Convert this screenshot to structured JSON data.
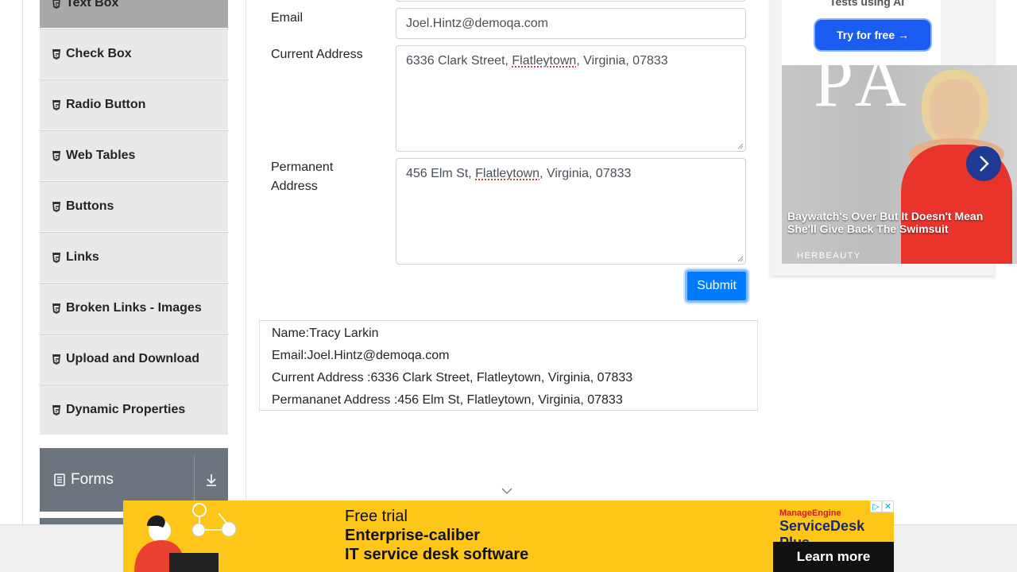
{
  "sidebar": {
    "items": [
      {
        "label": "Text Box",
        "active": true
      },
      {
        "label": "Check Box"
      },
      {
        "label": "Radio Button"
      },
      {
        "label": "Web Tables"
      },
      {
        "label": "Buttons"
      },
      {
        "label": "Links"
      },
      {
        "label": "Broken Links - Images"
      },
      {
        "label": "Upload and Download"
      },
      {
        "label": "Dynamic Properties"
      }
    ],
    "group_label": "Forms"
  },
  "form": {
    "email_label": "Email",
    "email_value": "Joel.Hintz@demoqa.com",
    "current_address_label": "Current Address",
    "current_address_parts": [
      "6336 Clark Street, ",
      "Flatleytown",
      ", Virginia, 07833"
    ],
    "permanent_address_label_1": "Permanent",
    "permanent_address_label_2": "Address",
    "permanent_address_parts": [
      "456 Elm St, ",
      "Flatleytown",
      ", Virginia, 07833"
    ],
    "submit_label": "Submit"
  },
  "output": {
    "name": "Name:Tracy Larkin",
    "email": "Email:Joel.Hintz@demoqa.com",
    "current": "Current Address :6336 Clark Street, Flatleytown, Virginia, 07833",
    "permanent": "Permananet Address :456 Elm St, Flatleytown, Virginia, 07833"
  },
  "ad_right": {
    "top_text": "Tests using AI",
    "try_button": "Try for free →",
    "photo_word": "PA",
    "caption": "Baywatch's Over But It Doesn't Mean She'll Give Back The Swimsuit",
    "source": "HERBEAUTY"
  },
  "banner": {
    "line1": "Free trial",
    "line2": "Enterprise-caliber",
    "line3": "IT service desk software",
    "brand_top": "ManageEngine",
    "brand_name": "ServiceDesk Plus",
    "cta": "Learn more",
    "colors": {
      "background": "#fdc619",
      "cta": "#111111"
    }
  },
  "colors": {
    "accent": "#007bff",
    "sidebar_active": "#a9a9a9",
    "group": "#6c757d"
  }
}
